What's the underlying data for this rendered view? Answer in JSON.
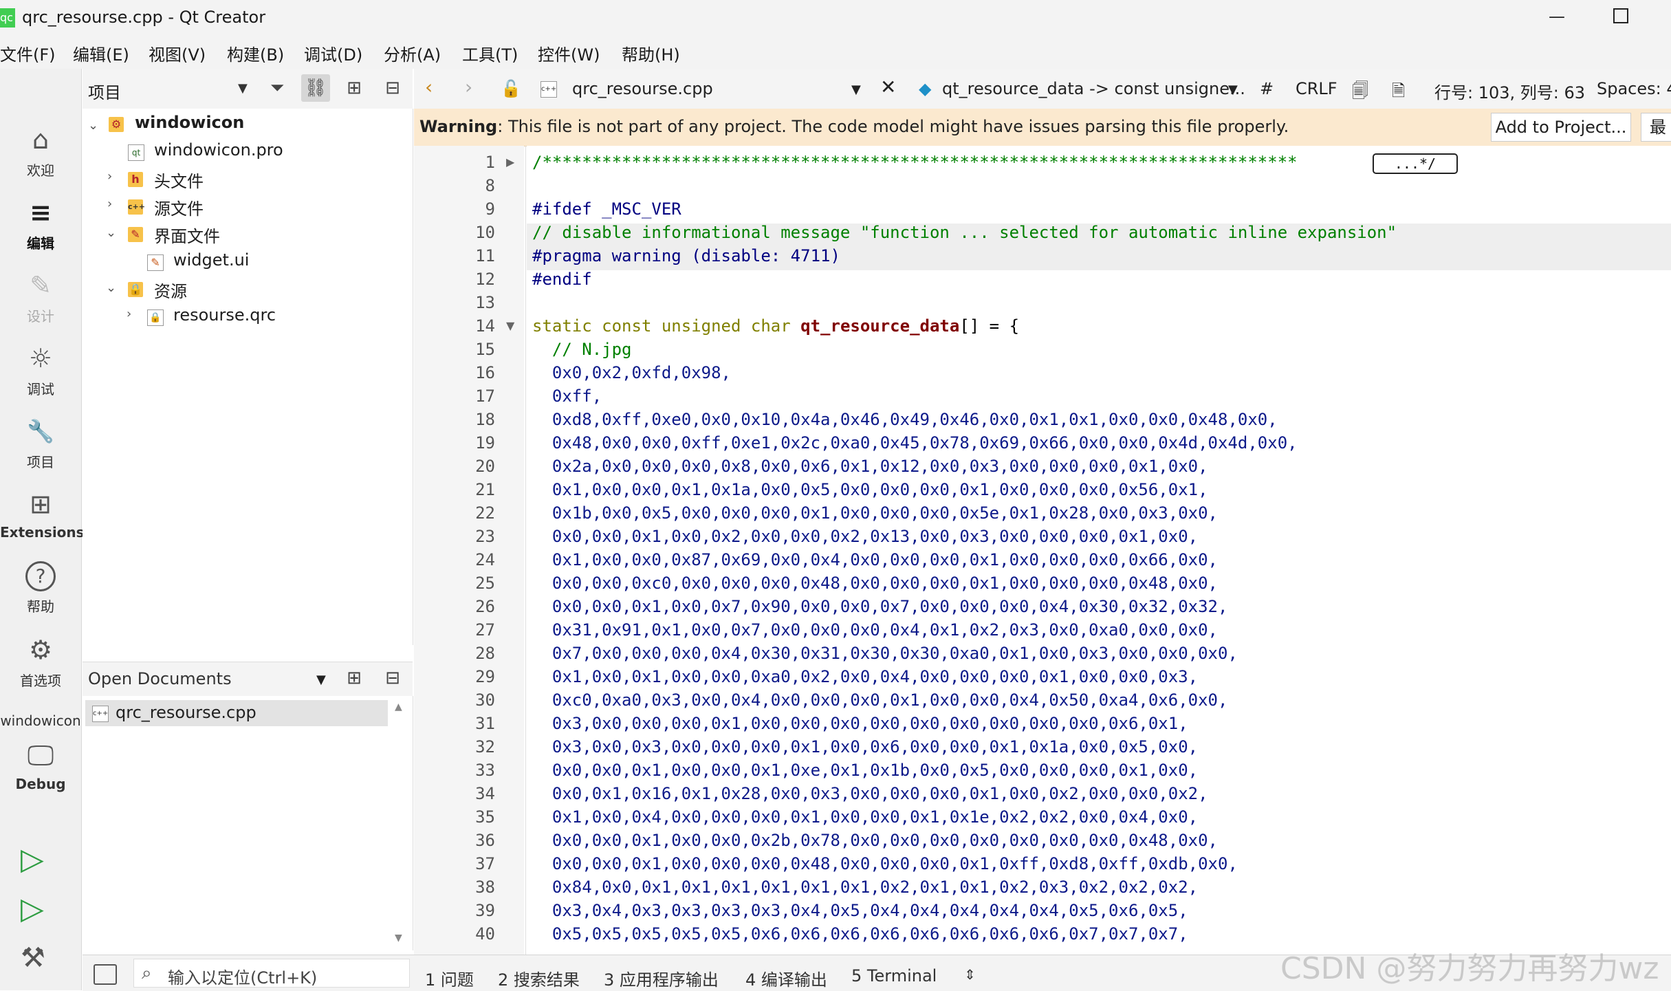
{
  "window": {
    "title": "qrc_resourse.cpp - Qt Creator",
    "app_icon": "qc"
  },
  "menu": [
    "文件(F)",
    "编辑(E)",
    "视图(V)",
    "构建(B)",
    "调试(D)",
    "分析(A)",
    "工具(T)",
    "控件(W)",
    "帮助(H)"
  ],
  "modes": [
    {
      "label": "欢迎",
      "icon": "home-icon",
      "glyph": "⌂"
    },
    {
      "label": "编辑",
      "icon": "edit-icon",
      "glyph": "≡"
    },
    {
      "label": "设计",
      "icon": "pen-icon",
      "glyph": "✎"
    },
    {
      "label": "调试",
      "icon": "bug-icon",
      "glyph": "☼"
    },
    {
      "label": "项目",
      "icon": "wrench-icon",
      "glyph": "🔧"
    },
    {
      "label": "Extensions",
      "icon": "extensions-icon",
      "glyph": "⊞"
    },
    {
      "label": "帮助",
      "icon": "help-icon",
      "glyph": "?"
    },
    {
      "label": "首选项",
      "icon": "gear-icon",
      "glyph": "⚙"
    }
  ],
  "kit": {
    "project": "windowicon",
    "config": "Debug"
  },
  "project_panel": {
    "title": "项目",
    "tree": [
      {
        "label": "windowicon",
        "type": "project"
      },
      {
        "label": "windowicon.pro",
        "type": "pro"
      },
      {
        "label": "头文件",
        "type": "folder-h"
      },
      {
        "label": "源文件",
        "type": "folder-cpp"
      },
      {
        "label": "界面文件",
        "type": "folder-ui"
      },
      {
        "label": "widget.ui",
        "type": "ui"
      },
      {
        "label": "资源",
        "type": "folder-res"
      },
      {
        "label": "resourse.qrc",
        "type": "qrc"
      }
    ]
  },
  "open_documents": {
    "title": "Open Documents",
    "items": [
      "qrc_resourse.cpp"
    ]
  },
  "editor_toolbar": {
    "file": "qrc_resourse.cpp",
    "symbol": "qt_resource_data -> const unsigne...",
    "hash": "#",
    "line_ending": "CRLF",
    "position": "行号: 103, 列号: 63",
    "spaces": "Spaces: 4"
  },
  "warning": {
    "label": "Warning",
    "message": ": This file is not part of any project. The code model might have issues parsing this file properly.",
    "button": "Add to Project...",
    "button2": "最"
  },
  "code": {
    "fold_box": "...*/",
    "lines": [
      {
        "n": "1",
        "text": "/****************************************************************************"
      },
      {
        "n": "8",
        "text": ""
      },
      {
        "n": "9",
        "text": "#ifdef _MSC_VER"
      },
      {
        "n": "10",
        "text": "// disable informational message \"function ... selected for automatic inline expansion\""
      },
      {
        "n": "11",
        "text": "#pragma warning (disable: 4711)"
      },
      {
        "n": "12",
        "text": "#endif"
      },
      {
        "n": "13",
        "text": ""
      },
      {
        "n": "14",
        "text": "static const unsigned char "
      },
      {
        "n": "15",
        "text": "  // N.jpg"
      },
      {
        "n": "16",
        "text": "  0x0,0x2,0xfd,0x98,"
      },
      {
        "n": "17",
        "text": "  0xff,"
      },
      {
        "n": "18",
        "text": "  0xd8,0xff,0xe0,0x0,0x10,0x4a,0x46,0x49,0x46,0x0,0x1,0x1,0x0,0x0,0x48,0x0,"
      },
      {
        "n": "19",
        "text": "  0x48,0x0,0x0,0xff,0xe1,0x2c,0xa0,0x45,0x78,0x69,0x66,0x0,0x0,0x4d,0x4d,0x0,"
      },
      {
        "n": "20",
        "text": "  0x2a,0x0,0x0,0x0,0x8,0x0,0x6,0x1,0x12,0x0,0x3,0x0,0x0,0x0,0x1,0x0,"
      },
      {
        "n": "21",
        "text": "  0x1,0x0,0x0,0x1,0x1a,0x0,0x5,0x0,0x0,0x0,0x1,0x0,0x0,0x0,0x56,0x1,"
      },
      {
        "n": "22",
        "text": "  0x1b,0x0,0x5,0x0,0x0,0x0,0x1,0x0,0x0,0x0,0x5e,0x1,0x28,0x0,0x3,0x0,"
      },
      {
        "n": "23",
        "text": "  0x0,0x0,0x1,0x0,0x2,0x0,0x0,0x2,0x13,0x0,0x3,0x0,0x0,0x0,0x1,0x0,"
      },
      {
        "n": "24",
        "text": "  0x1,0x0,0x0,0x87,0x69,0x0,0x4,0x0,0x0,0x0,0x1,0x0,0x0,0x0,0x66,0x0,"
      },
      {
        "n": "25",
        "text": "  0x0,0x0,0xc0,0x0,0x0,0x0,0x48,0x0,0x0,0x0,0x1,0x0,0x0,0x0,0x48,0x0,"
      },
      {
        "n": "26",
        "text": "  0x0,0x0,0x1,0x0,0x7,0x90,0x0,0x0,0x7,0x0,0x0,0x0,0x4,0x30,0x32,0x32,"
      },
      {
        "n": "27",
        "text": "  0x31,0x91,0x1,0x0,0x7,0x0,0x0,0x0,0x4,0x1,0x2,0x3,0x0,0xa0,0x0,0x0,"
      },
      {
        "n": "28",
        "text": "  0x7,0x0,0x0,0x0,0x4,0x30,0x31,0x30,0x30,0xa0,0x1,0x0,0x3,0x0,0x0,0x0,"
      },
      {
        "n": "29",
        "text": "  0x1,0x0,0x1,0x0,0x0,0xa0,0x2,0x0,0x4,0x0,0x0,0x0,0x1,0x0,0x0,0x3,"
      },
      {
        "n": "30",
        "text": "  0xc0,0xa0,0x3,0x0,0x4,0x0,0x0,0x0,0x1,0x0,0x0,0x4,0x50,0xa4,0x6,0x0,"
      },
      {
        "n": "31",
        "text": "  0x3,0x0,0x0,0x0,0x1,0x0,0x0,0x0,0x0,0x0,0x0,0x0,0x0,0x0,0x6,0x1,"
      },
      {
        "n": "32",
        "text": "  0x3,0x0,0x3,0x0,0x0,0x0,0x1,0x0,0x6,0x0,0x0,0x1,0x1a,0x0,0x5,0x0,"
      },
      {
        "n": "33",
        "text": "  0x0,0x0,0x1,0x0,0x0,0x1,0xe,0x1,0x1b,0x0,0x5,0x0,0x0,0x0,0x1,0x0,"
      },
      {
        "n": "34",
        "text": "  0x0,0x1,0x16,0x1,0x28,0x0,0x3,0x0,0x0,0x0,0x1,0x0,0x2,0x0,0x0,0x2,"
      },
      {
        "n": "35",
        "text": "  0x1,0x0,0x4,0x0,0x0,0x0,0x1,0x0,0x0,0x1,0x1e,0x2,0x2,0x0,0x4,0x0,"
      },
      {
        "n": "36",
        "text": "  0x0,0x0,0x1,0x0,0x0,0x2b,0x78,0x0,0x0,0x0,0x0,0x0,0x0,0x0,0x48,0x0,"
      },
      {
        "n": "37",
        "text": "  0x0,0x0,0x1,0x0,0x0,0x0,0x48,0x0,0x0,0x0,0x1,0xff,0xd8,0xff,0xdb,0x0,"
      },
      {
        "n": "38",
        "text": "  0x84,0x0,0x1,0x1,0x1,0x1,0x1,0x1,0x2,0x1,0x1,0x2,0x3,0x2,0x2,0x2,"
      },
      {
        "n": "39",
        "text": "  0x3,0x4,0x3,0x3,0x3,0x3,0x4,0x5,0x4,0x4,0x4,0x4,0x4,0x5,0x6,0x5,"
      },
      {
        "n": "40",
        "text": "  0x5,0x5,0x5,0x5,0x5,0x6,0x6,0x6,0x6,0x6,0x6,0x6,0x6,0x7,0x7,0x7,"
      }
    ],
    "line14_name": "qt_resource_data",
    "line14_tail": "[] = {"
  },
  "status": {
    "locator_placeholder": "输入以定位(Ctrl+K)",
    "tabs": [
      "1  问题",
      "2  搜索结果",
      "3  应用程序输出",
      "4  编译输出",
      "5  Terminal"
    ]
  },
  "watermark": "CSDN @努力努力再努力wz"
}
